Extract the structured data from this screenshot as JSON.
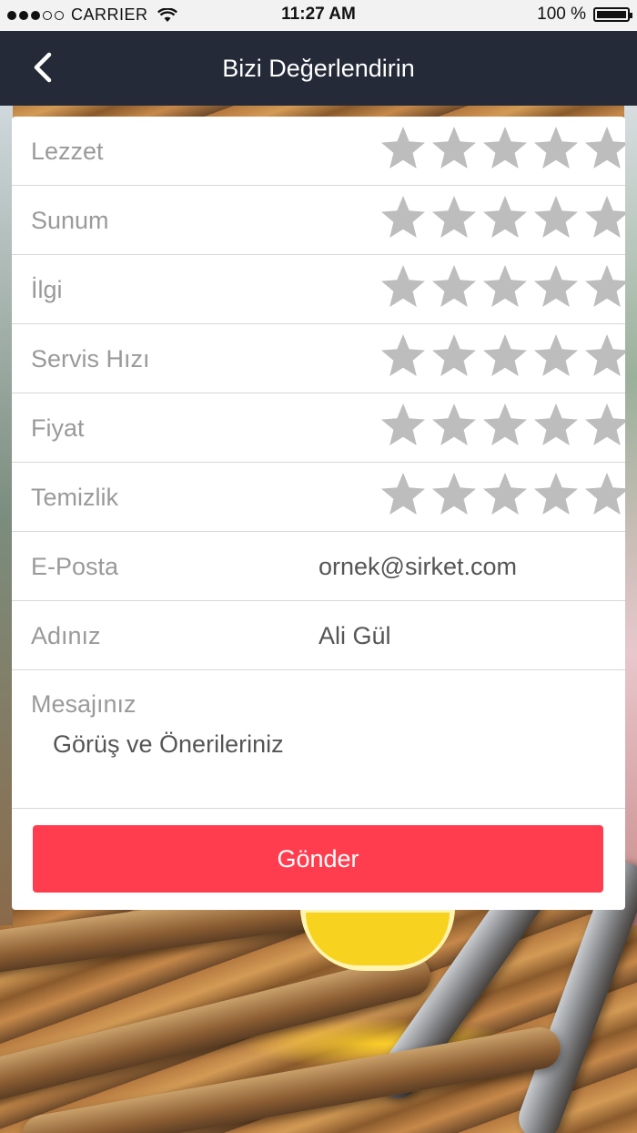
{
  "status": {
    "carrier": "CARRIER",
    "time": "11:27 AM",
    "battery": "100 %"
  },
  "nav": {
    "title": "Bizi Değerlendirin"
  },
  "ratings": [
    {
      "label": "Lezzet",
      "stars": 0,
      "max": 5
    },
    {
      "label": "Sunum",
      "stars": 0,
      "max": 5
    },
    {
      "label": "İlgi",
      "stars": 0,
      "max": 5
    },
    {
      "label": "Servis Hızı",
      "stars": 0,
      "max": 5
    },
    {
      "label": "Fiyat",
      "stars": 0,
      "max": 5
    },
    {
      "label": "Temizlik",
      "stars": 0,
      "max": 5
    }
  ],
  "form": {
    "email_label": "E-Posta",
    "email_placeholder": "ornek@sirket.com",
    "name_label": "Adınız",
    "name_placeholder": "Ali Gül",
    "message_label": "Mesajınız",
    "message_placeholder": "Görüş ve Önerileriniz",
    "submit_label": "Gönder"
  },
  "colors": {
    "navbar": "#252a38",
    "submit": "#ff3d4e",
    "star_inactive": "#bdbdbd"
  }
}
